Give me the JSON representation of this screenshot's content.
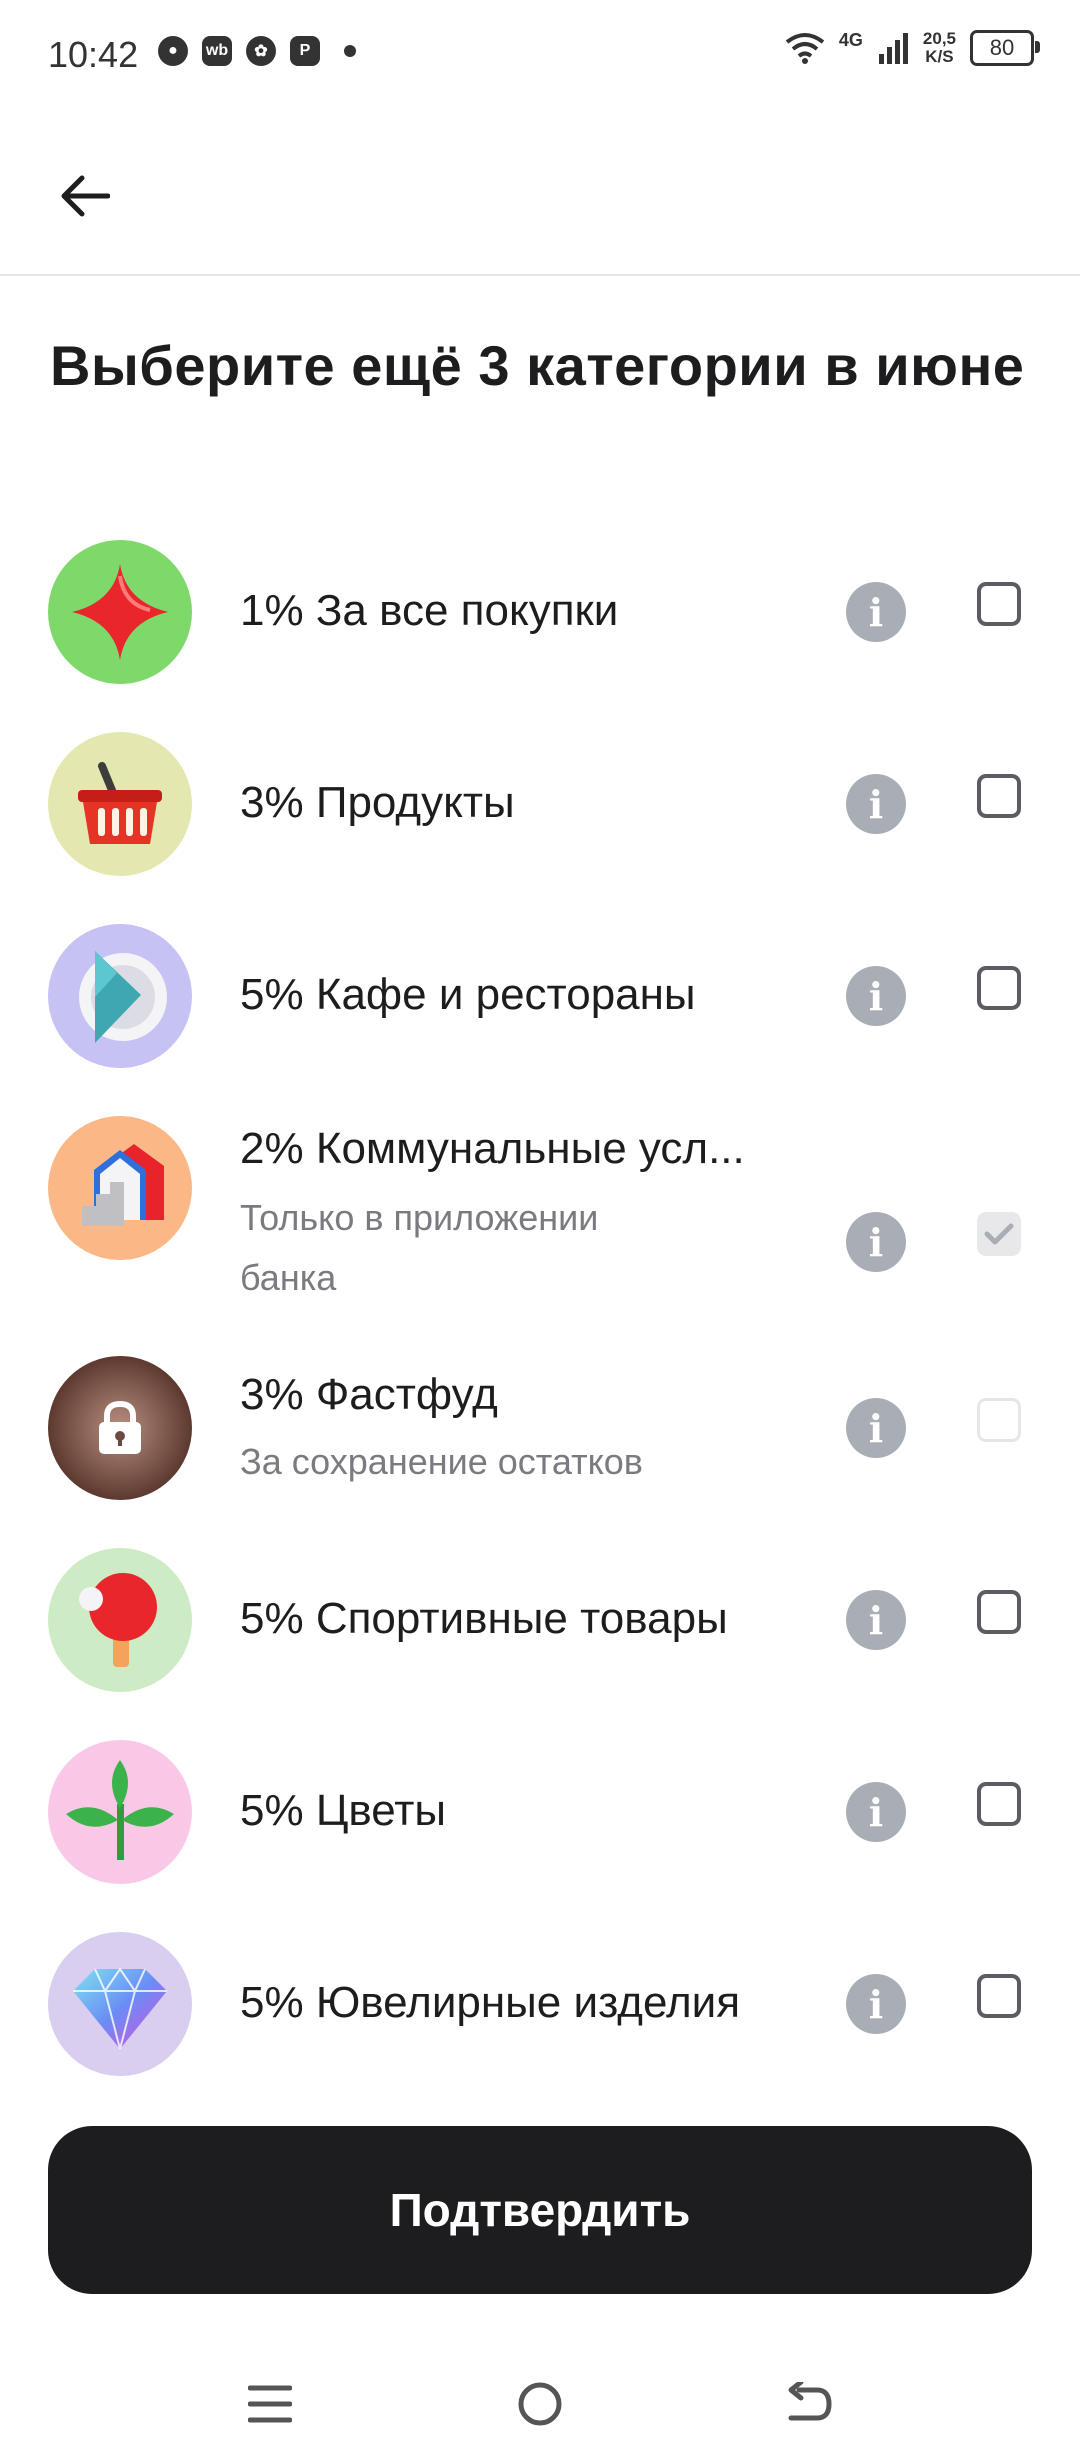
{
  "status_bar": {
    "time": "10:42",
    "notif_wb": "wb",
    "network": "4G",
    "speed_value": "20,5",
    "speed_unit": "K/S",
    "battery": "80"
  },
  "header": {
    "back_icon": "arrow-left-icon"
  },
  "title": "Выберите ещё 3 категории в июне",
  "categories": [
    {
      "label": "1% За все покупки",
      "icon": "star-icon",
      "bg": "#7ed86a",
      "state": "unchecked"
    },
    {
      "label": "3% Продукты",
      "icon": "basket-icon",
      "bg": "#e4e8b0",
      "state": "unchecked"
    },
    {
      "label": "5% Кафе и рестораны",
      "icon": "plate-icon",
      "bg": "#c7c2f4",
      "state": "unchecked"
    },
    {
      "label": "2% Коммунальные усл...",
      "sub": "Только в приложении банка",
      "icon": "house-icon",
      "bg": "#fbb886",
      "state": "checked-disabled"
    },
    {
      "label": "3% Фастфуд",
      "sub": "За сохранение остатков",
      "icon": "lock-icon",
      "bg": "#6b4a40",
      "state": "disabled"
    },
    {
      "label": "5% Спортивные товары",
      "icon": "ping-pong-icon",
      "bg": "#cdebc4",
      "state": "unchecked"
    },
    {
      "label": "5% Цветы",
      "icon": "plant-icon",
      "bg": "#f9c8e6",
      "state": "unchecked"
    },
    {
      "label": "5% Ювелирные изделия",
      "icon": "diamond-icon",
      "bg": "#d9cdf0",
      "state": "unchecked"
    }
  ],
  "confirm_label": "Подтвердить",
  "nav": {
    "menu": "menu-icon",
    "home": "home-icon",
    "back": "back-icon"
  }
}
